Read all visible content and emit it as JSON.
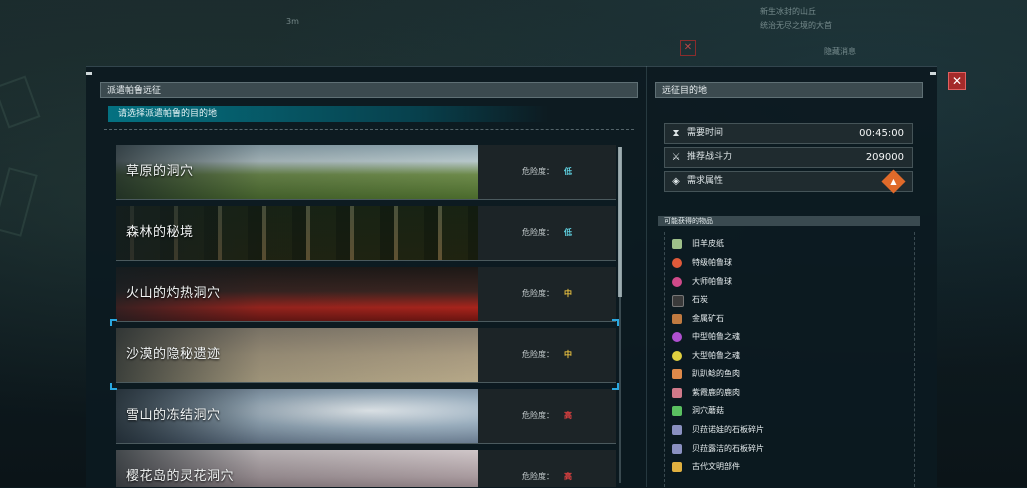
{
  "background": {
    "distance_marker": "3m",
    "notification_lines": [
      "新生冰封的山丘",
      "统治无尽之境的大首"
    ],
    "notification_link": "隐藏消息"
  },
  "left_panel": {
    "title": "派遣帕鲁远征",
    "subtitle": "请选择派遣帕鲁的目的地",
    "danger_prefix": "危险度：",
    "destinations": [
      {
        "name": "草原的洞穴",
        "danger": "低",
        "danger_color": "#5fd0e0",
        "selected": false
      },
      {
        "name": "森林的秘境",
        "danger": "低",
        "danger_color": "#5fd0e0",
        "selected": false
      },
      {
        "name": "火山的灼热洞穴",
        "danger": "中",
        "danger_color": "#e8c040",
        "selected": false
      },
      {
        "name": "沙漠的隐秘遗迹",
        "danger": "中",
        "danger_color": "#e8c040",
        "selected": true
      },
      {
        "name": "雪山的冻结洞穴",
        "danger": "高",
        "danger_color": "#e04040",
        "selected": false
      },
      {
        "name": "樱花岛的灵花洞穴",
        "danger": "高",
        "danger_color": "#e04040",
        "selected": false
      }
    ]
  },
  "right_panel": {
    "title": "远征目的地",
    "required_time_label": "需要时间",
    "required_time_value": "00:45:00",
    "recommended_power_label": "推荐战斗力",
    "recommended_power_value": "209000",
    "required_attribute_label": "需求属性",
    "required_attribute_icon": "fire-element-icon",
    "items_header": "可能获得的物品",
    "items": [
      {
        "name": "旧羊皮纸",
        "icon": "parchment-icon",
        "color": "#9fc08a"
      },
      {
        "name": "特级帕鲁球",
        "icon": "palsphere-icon",
        "color": "#e05a3a"
      },
      {
        "name": "大师帕鲁球",
        "icon": "palsphere-icon",
        "color": "#d04a8a"
      },
      {
        "name": "石炭",
        "icon": "coal-icon",
        "color": "#3a3a3a"
      },
      {
        "name": "金属矿石",
        "icon": "ore-icon",
        "color": "#c07a40"
      },
      {
        "name": "中型帕鲁之魂",
        "icon": "soul-icon",
        "color": "#b050d0"
      },
      {
        "name": "大型帕鲁之魂",
        "icon": "soul-icon",
        "color": "#e0d040"
      },
      {
        "name": "趴趴鲶的鱼肉",
        "icon": "meat-icon",
        "color": "#e08a4a"
      },
      {
        "name": "紫霞鹿的鹿肉",
        "icon": "meat-icon",
        "color": "#d07a8a"
      },
      {
        "name": "洞穴蘑菇",
        "icon": "mushroom-icon",
        "color": "#5ac060"
      },
      {
        "name": "贝菈诺娃的石板碎片",
        "icon": "slab-icon",
        "color": "#8a90c0"
      },
      {
        "name": "贝菈露洁的石板碎片",
        "icon": "slab-icon",
        "color": "#8a90c0"
      },
      {
        "name": "古代文明部件",
        "icon": "ancient-part-icon",
        "color": "#e0b040"
      }
    ]
  }
}
